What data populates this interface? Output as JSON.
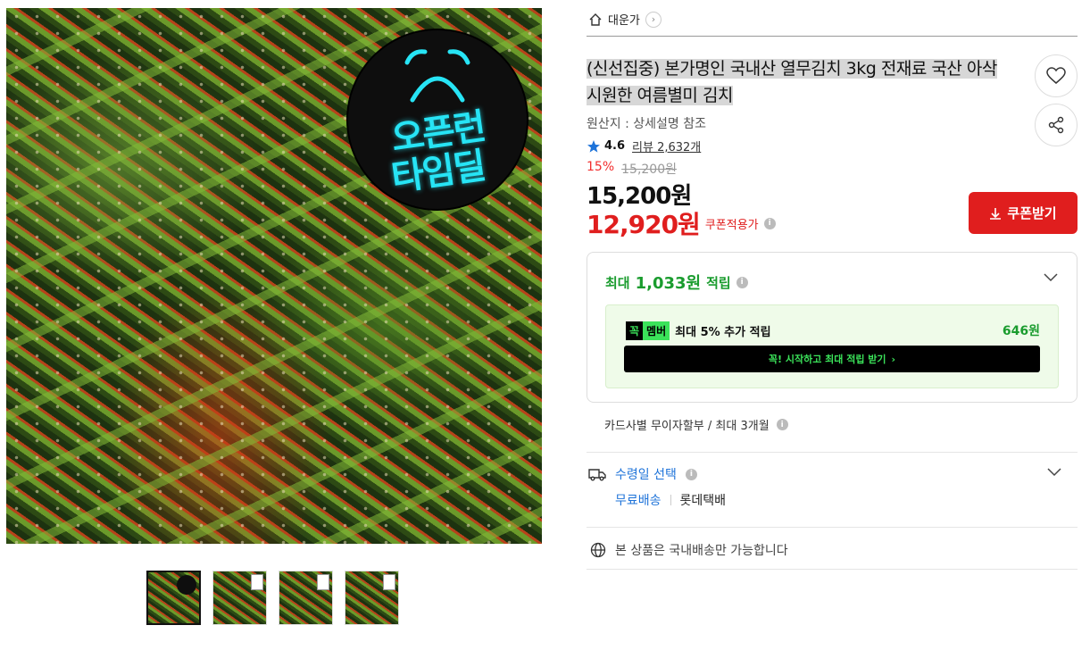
{
  "product": {
    "image_alt": "열무김치",
    "promo_badge": {
      "line1": "오픈런",
      "line2": "타임딜"
    },
    "thumbnail_count": 4
  },
  "shop": {
    "name": "대운가"
  },
  "title": "(신선집중) 본가명인 국내산 열무김치 3kg 전재료 국산 아삭 시원한 여름별미 김치",
  "origin": "원산지 : 상세설명 참조",
  "rating": {
    "score": "4.6",
    "review_label": "리뷰 2,632개"
  },
  "price": {
    "discount_rate": "15%",
    "original": "15,200원",
    "sale": "15,200원",
    "coupon_price": "12,920원",
    "coupon_price_label": "쿠폰적용가"
  },
  "coupon_button": {
    "label": "쿠폰받기"
  },
  "points": {
    "label_prefix": "최대",
    "amount": "1,033원",
    "label_suffix": "적립",
    "member": {
      "logo_k": "꼭",
      "logo_m": "멤버",
      "text": "최대 5% 추가 적립",
      "points": "646원",
      "join_label": "꼭! 시작하고 최대 적립 받기"
    }
  },
  "installment": "카드사별 무이자할부 / 최대 3개월",
  "delivery": {
    "label": "수령일 선택",
    "free": "무료배송",
    "carrier": "롯데택배"
  },
  "domestic_note": "본 상품은 국내배송만 가능합니다",
  "colors": {
    "accent_red": "#e01e1e",
    "points_green": "#1a9c2e",
    "link_blue": "#1e73d9",
    "member_green": "#3be35a"
  }
}
